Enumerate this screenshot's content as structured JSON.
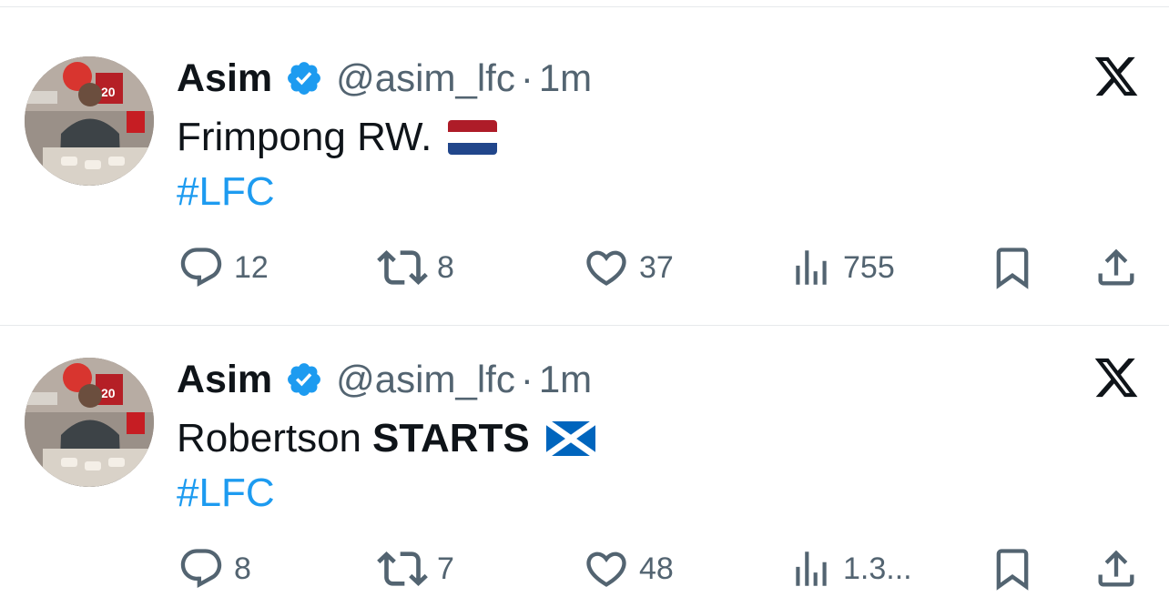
{
  "colors": {
    "text": "#0f1419",
    "secondary": "#536471",
    "link": "#1d9bf0",
    "verified": "#1d9bf0",
    "divider": "#e6e9eb"
  },
  "tweets": [
    {
      "author_name": "Asim",
      "handle": "@asim_lfc",
      "separator": "·",
      "time": "1m",
      "text_plain": "Frimpong RW.",
      "text_bold": "",
      "flag_icon": "netherlands-flag-icon",
      "hashtag": "#LFC",
      "replies": "12",
      "reposts": "8",
      "likes": "37",
      "views": "755"
    },
    {
      "author_name": "Asim",
      "handle": "@asim_lfc",
      "separator": "·",
      "time": "1m",
      "text_plain": "Robertson",
      "text_bold": "STARTS",
      "flag_icon": "scotland-flag-icon",
      "hashtag": "#LFC",
      "replies": "8",
      "reposts": "7",
      "likes": "48",
      "views": "1.3..."
    }
  ]
}
